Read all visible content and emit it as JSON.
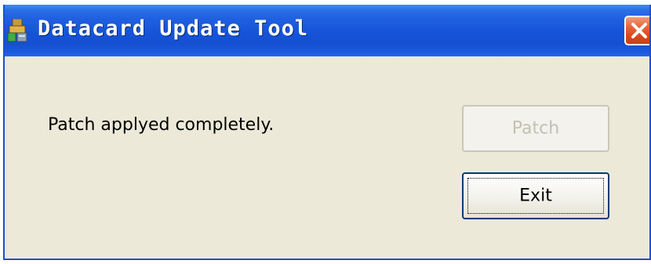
{
  "window": {
    "title": "Datacard Update Tool",
    "app_icon": "installer-icon",
    "close_icon": "close-icon",
    "close_color": "#d84a1c",
    "titlebar_color": "#1553d8",
    "body_color": "#ece9d8"
  },
  "content": {
    "status_message": "Patch applyed completely."
  },
  "buttons": {
    "patch": {
      "label": "Patch",
      "enabled": false
    },
    "exit": {
      "label": "Exit",
      "enabled": true,
      "focused": true
    }
  }
}
